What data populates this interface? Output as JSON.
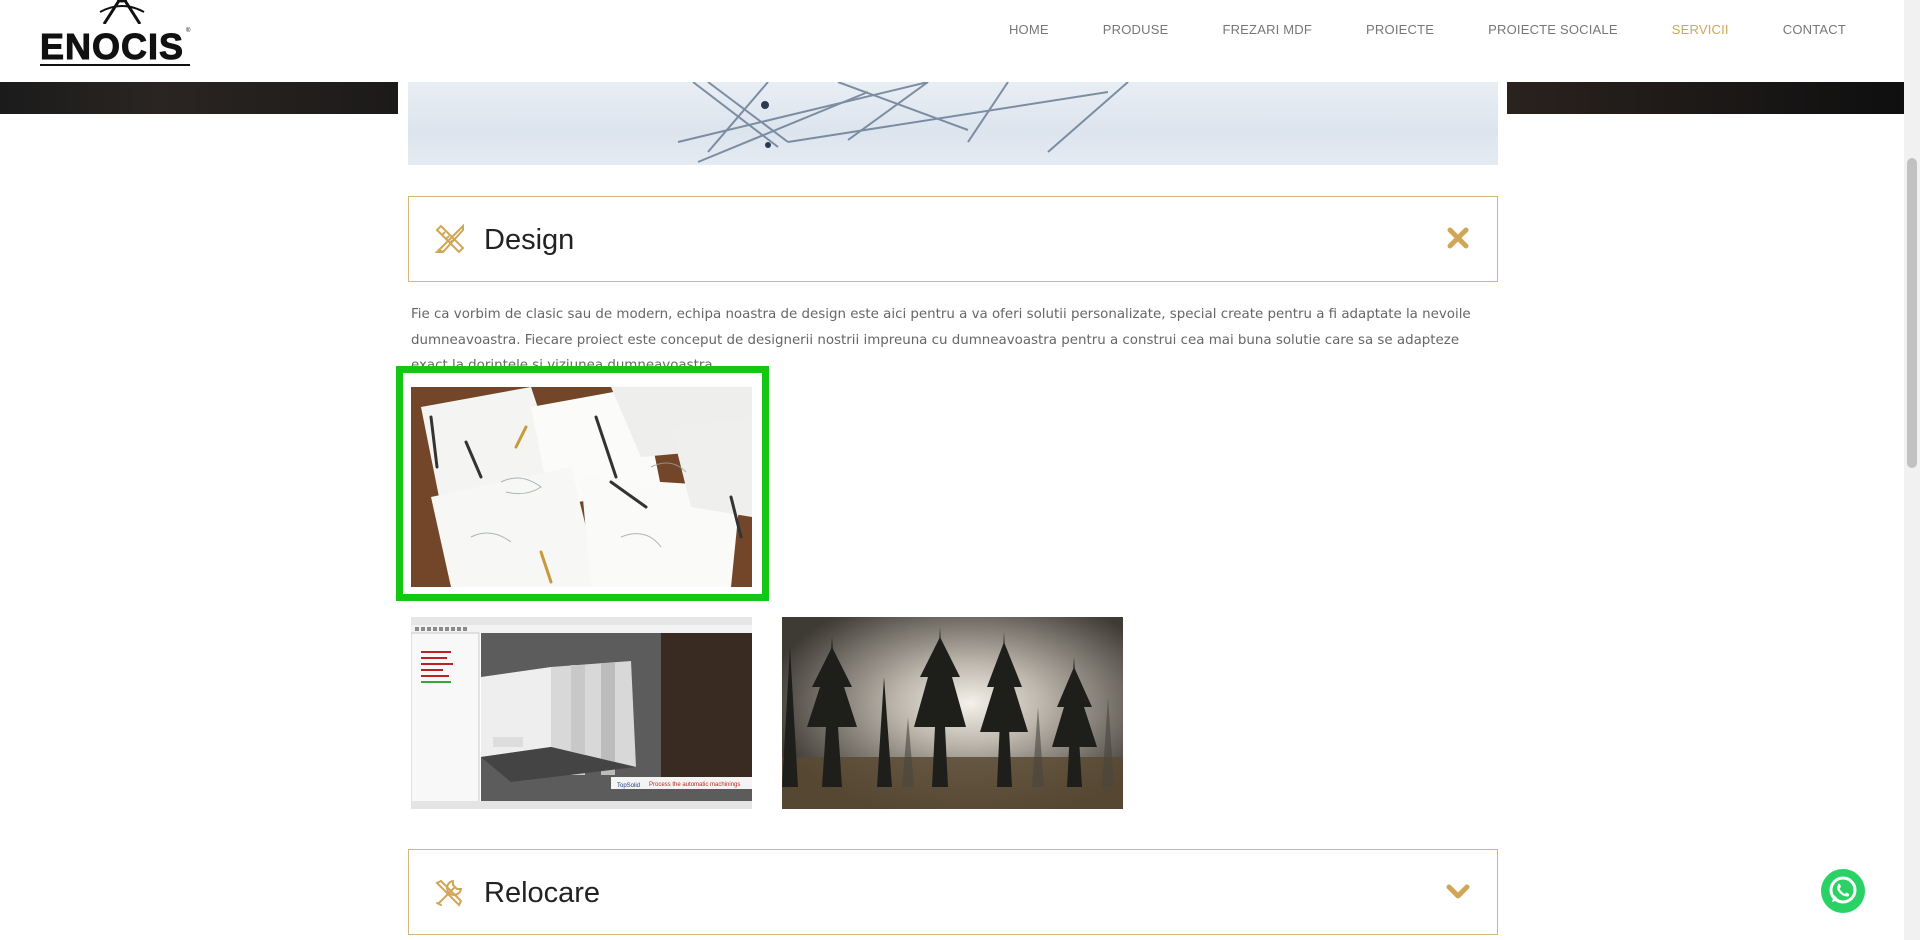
{
  "header": {
    "logo_text": "ENOCIS",
    "nav": [
      {
        "label": "HOME"
      },
      {
        "label": "PRODUSE"
      },
      {
        "label": "FREZARI MDF"
      },
      {
        "label": "PROIECTE"
      },
      {
        "label": "PROIECTE SOCIALE"
      },
      {
        "label": "SERVICII"
      },
      {
        "label": "CONTACT"
      }
    ],
    "active_nav": "SERVICII"
  },
  "colors": {
    "accent": "#d2a657",
    "border": "#d2b77a",
    "highlight": "#15c715",
    "whatsapp": "#2ad265"
  },
  "sections": {
    "design": {
      "title": "Design",
      "icon": "pencil-ruler-icon",
      "toggle_icon": "close-icon",
      "description": "Fie ca vorbim de clasic sau de modern, echipa noastra de design este aici pentru a va oferi solutii personalizate, special create pentru a fi adaptate la nevoile dumneavoastra. Fiecare proiect este conceput de designerii nostrii impreuna cu dumneavoastra pentru a construi cea mai buna solutie care sa se adapteze exact la dorintele si viziunea dumneavoastra."
    },
    "relocare": {
      "title": "Relocare",
      "icon": "tools-icon",
      "toggle_icon": "chevron-down-icon"
    }
  },
  "gallery": {
    "cad_banner": "Process the automatic machinings",
    "cad_brand": "TopSolid"
  }
}
